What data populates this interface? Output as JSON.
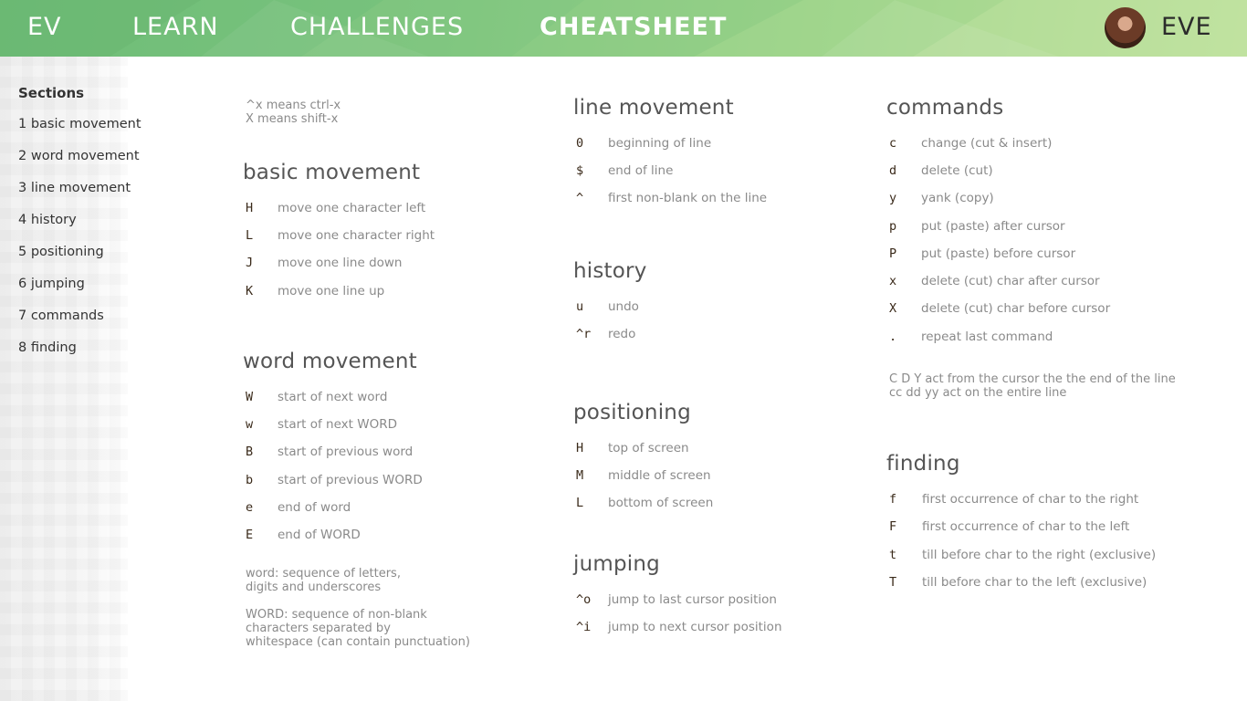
{
  "header": {
    "brand": "EV",
    "nav": [
      {
        "label": "LEARN"
      },
      {
        "label": "CHALLENGES"
      },
      {
        "label": "CHEATSHEET",
        "active": true
      }
    ],
    "user": "EVE"
  },
  "sidebar": {
    "title": "Sections",
    "links": [
      "1 basic movement",
      "2 word movement",
      "3 line movement",
      "4 history",
      "5 positioning",
      "6 jumping",
      "7 commands",
      "8 finding"
    ]
  },
  "intro": "^x means ctrl-x\nX means shift-x",
  "sections": {
    "basic": {
      "title": "basic movement",
      "rows": [
        {
          "key": "H",
          "desc": "move one character left"
        },
        {
          "key": "L",
          "desc": "move one character right"
        },
        {
          "key": "J",
          "desc": "move one line down"
        },
        {
          "key": "K",
          "desc": "move one line up"
        }
      ]
    },
    "word": {
      "title": "word movement",
      "rows": [
        {
          "key": "W",
          "desc": "start of next word"
        },
        {
          "key": "w",
          "desc": "start of next WORD"
        },
        {
          "key": "B",
          "desc": "start of previous word"
        },
        {
          "key": "b",
          "desc": "start of previous WORD"
        },
        {
          "key": "e",
          "desc": "end of word"
        },
        {
          "key": "E",
          "desc": "end of WORD"
        }
      ],
      "note1": "word: sequence of letters,\ndigits and underscores",
      "note2": "WORD: sequence of non-blank\ncharacters separated by\nwhitespace (can contain punctuation)"
    },
    "line": {
      "title": "line movement",
      "rows": [
        {
          "key": "0",
          "desc": "beginning of line"
        },
        {
          "key": "$",
          "desc": "end of line"
        },
        {
          "key": "^",
          "desc": "first non-blank on the line"
        }
      ]
    },
    "history": {
      "title": "history",
      "rows": [
        {
          "key": "u",
          "desc": "undo"
        },
        {
          "key": "^r",
          "desc": "redo"
        }
      ]
    },
    "positioning": {
      "title": "positioning",
      "rows": [
        {
          "key": "H",
          "desc": "top of screen"
        },
        {
          "key": "M",
          "desc": "middle of screen"
        },
        {
          "key": "L",
          "desc": "bottom of screen"
        }
      ]
    },
    "jumping": {
      "title": "jumping",
      "rows": [
        {
          "key": "^o",
          "desc": "jump to last cursor position"
        },
        {
          "key": "^i",
          "desc": "jump to next cursor position"
        }
      ]
    },
    "commands": {
      "title": "commands",
      "rows": [
        {
          "key": "c",
          "desc": "change (cut & insert)"
        },
        {
          "key": "d",
          "desc": "delete (cut)"
        },
        {
          "key": "y",
          "desc": "yank (copy)"
        },
        {
          "key": "p",
          "desc": "put (paste) after cursor"
        },
        {
          "key": "P",
          "desc": "put (paste) before cursor"
        },
        {
          "key": "x",
          "desc": "delete (cut) char after cursor"
        },
        {
          "key": "X",
          "desc": "delete (cut) char before cursor"
        },
        {
          "key": ".",
          "desc": "repeat last command"
        }
      ],
      "note": "C D Y act from the cursor the the end of the line\ncc dd yy act on the entire line"
    },
    "finding": {
      "title": "finding",
      "rows": [
        {
          "key": "f",
          "desc": "first occurrence of char to the right"
        },
        {
          "key": "F",
          "desc": "first occurrence of char to the left"
        },
        {
          "key": "t",
          "desc": "till before char to the right (exclusive)"
        },
        {
          "key": "T",
          "desc": "till before char to the left (exclusive)"
        }
      ]
    }
  }
}
